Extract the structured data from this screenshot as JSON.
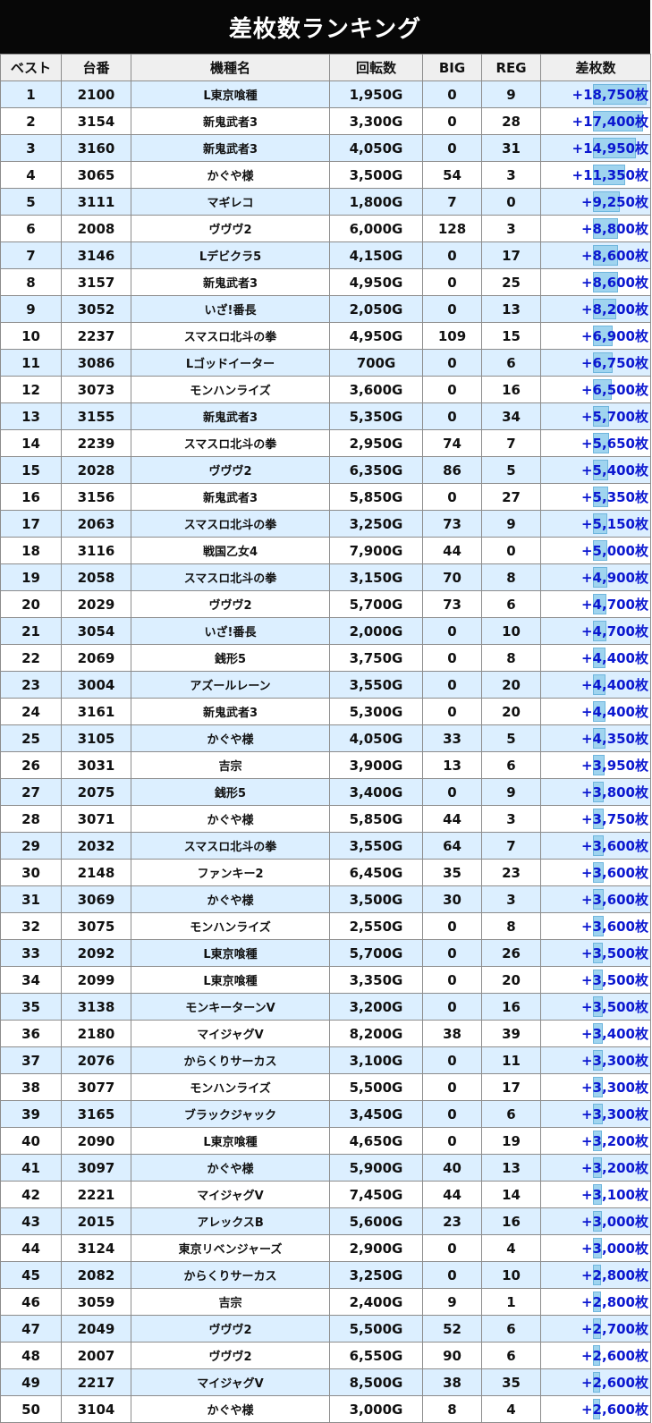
{
  "title": "差枚数ランキング",
  "colors": {
    "title_bg": "#070707",
    "header_bg": "#efefef",
    "row_alt_bg": "#dcefff",
    "diff_text": "#0b17d0",
    "diff_bar": "#9fd4ef"
  },
  "columns": [
    "ベスト",
    "台番",
    "機種名",
    "回転数",
    "BIG",
    "REG",
    "差枚数"
  ],
  "rows": [
    {
      "rank": "1",
      "machine_no": "2100",
      "name": "L東京喰種",
      "spins": "1,950G",
      "big": "0",
      "reg": "9",
      "diff": "+18,750枚",
      "diff_value": 18750
    },
    {
      "rank": "2",
      "machine_no": "3154",
      "name": "新鬼武者3",
      "spins": "3,300G",
      "big": "0",
      "reg": "28",
      "diff": "+17,400枚",
      "diff_value": 17400
    },
    {
      "rank": "3",
      "machine_no": "3160",
      "name": "新鬼武者3",
      "spins": "4,050G",
      "big": "0",
      "reg": "31",
      "diff": "+14,950枚",
      "diff_value": 14950
    },
    {
      "rank": "4",
      "machine_no": "3065",
      "name": "かぐや様",
      "spins": "3,500G",
      "big": "54",
      "reg": "3",
      "diff": "+11,350枚",
      "diff_value": 11350
    },
    {
      "rank": "5",
      "machine_no": "3111",
      "name": "マギレコ",
      "spins": "1,800G",
      "big": "7",
      "reg": "0",
      "diff": "+9,250枚",
      "diff_value": 9250
    },
    {
      "rank": "6",
      "machine_no": "2008",
      "name": "ヴヴヴ2",
      "spins": "6,000G",
      "big": "128",
      "reg": "3",
      "diff": "+8,800枚",
      "diff_value": 8800
    },
    {
      "rank": "7",
      "machine_no": "3146",
      "name": "Lデビクラ5",
      "spins": "4,150G",
      "big": "0",
      "reg": "17",
      "diff": "+8,600枚",
      "diff_value": 8600
    },
    {
      "rank": "8",
      "machine_no": "3157",
      "name": "新鬼武者3",
      "spins": "4,950G",
      "big": "0",
      "reg": "25",
      "diff": "+8,600枚",
      "diff_value": 8600
    },
    {
      "rank": "9",
      "machine_no": "3052",
      "name": "いざ!番長",
      "spins": "2,050G",
      "big": "0",
      "reg": "13",
      "diff": "+8,200枚",
      "diff_value": 8200
    },
    {
      "rank": "10",
      "machine_no": "2237",
      "name": "スマスロ北斗の拳",
      "spins": "4,950G",
      "big": "109",
      "reg": "15",
      "diff": "+6,900枚",
      "diff_value": 6900
    },
    {
      "rank": "11",
      "machine_no": "3086",
      "name": "Lゴッドイーター",
      "spins": "700G",
      "big": "0",
      "reg": "6",
      "diff": "+6,750枚",
      "diff_value": 6750
    },
    {
      "rank": "12",
      "machine_no": "3073",
      "name": "モンハンライズ",
      "spins": "3,600G",
      "big": "0",
      "reg": "16",
      "diff": "+6,500枚",
      "diff_value": 6500
    },
    {
      "rank": "13",
      "machine_no": "3155",
      "name": "新鬼武者3",
      "spins": "5,350G",
      "big": "0",
      "reg": "34",
      "diff": "+5,700枚",
      "diff_value": 5700
    },
    {
      "rank": "14",
      "machine_no": "2239",
      "name": "スマスロ北斗の拳",
      "spins": "2,950G",
      "big": "74",
      "reg": "7",
      "diff": "+5,650枚",
      "diff_value": 5650
    },
    {
      "rank": "15",
      "machine_no": "2028",
      "name": "ヴヴヴ2",
      "spins": "6,350G",
      "big": "86",
      "reg": "5",
      "diff": "+5,400枚",
      "diff_value": 5400
    },
    {
      "rank": "16",
      "machine_no": "3156",
      "name": "新鬼武者3",
      "spins": "5,850G",
      "big": "0",
      "reg": "27",
      "diff": "+5,350枚",
      "diff_value": 5350
    },
    {
      "rank": "17",
      "machine_no": "2063",
      "name": "スマスロ北斗の拳",
      "spins": "3,250G",
      "big": "73",
      "reg": "9",
      "diff": "+5,150枚",
      "diff_value": 5150
    },
    {
      "rank": "18",
      "machine_no": "3116",
      "name": "戦国乙女4",
      "spins": "7,900G",
      "big": "44",
      "reg": "0",
      "diff": "+5,000枚",
      "diff_value": 5000
    },
    {
      "rank": "19",
      "machine_no": "2058",
      "name": "スマスロ北斗の拳",
      "spins": "3,150G",
      "big": "70",
      "reg": "8",
      "diff": "+4,900枚",
      "diff_value": 4900
    },
    {
      "rank": "20",
      "machine_no": "2029",
      "name": "ヴヴヴ2",
      "spins": "5,700G",
      "big": "73",
      "reg": "6",
      "diff": "+4,700枚",
      "diff_value": 4700
    },
    {
      "rank": "21",
      "machine_no": "3054",
      "name": "いざ!番長",
      "spins": "2,000G",
      "big": "0",
      "reg": "10",
      "diff": "+4,700枚",
      "diff_value": 4700
    },
    {
      "rank": "22",
      "machine_no": "2069",
      "name": "銭形5",
      "spins": "3,750G",
      "big": "0",
      "reg": "8",
      "diff": "+4,400枚",
      "diff_value": 4400
    },
    {
      "rank": "23",
      "machine_no": "3004",
      "name": "アズールレーン",
      "spins": "3,550G",
      "big": "0",
      "reg": "20",
      "diff": "+4,400枚",
      "diff_value": 4400
    },
    {
      "rank": "24",
      "machine_no": "3161",
      "name": "新鬼武者3",
      "spins": "5,300G",
      "big": "0",
      "reg": "20",
      "diff": "+4,400枚",
      "diff_value": 4400
    },
    {
      "rank": "25",
      "machine_no": "3105",
      "name": "かぐや様",
      "spins": "4,050G",
      "big": "33",
      "reg": "5",
      "diff": "+4,350枚",
      "diff_value": 4350
    },
    {
      "rank": "26",
      "machine_no": "3031",
      "name": "吉宗",
      "spins": "3,900G",
      "big": "13",
      "reg": "6",
      "diff": "+3,950枚",
      "diff_value": 3950
    },
    {
      "rank": "27",
      "machine_no": "2075",
      "name": "銭形5",
      "spins": "3,400G",
      "big": "0",
      "reg": "9",
      "diff": "+3,800枚",
      "diff_value": 3800
    },
    {
      "rank": "28",
      "machine_no": "3071",
      "name": "かぐや様",
      "spins": "5,850G",
      "big": "44",
      "reg": "3",
      "diff": "+3,750枚",
      "diff_value": 3750
    },
    {
      "rank": "29",
      "machine_no": "2032",
      "name": "スマスロ北斗の拳",
      "spins": "3,550G",
      "big": "64",
      "reg": "7",
      "diff": "+3,600枚",
      "diff_value": 3600
    },
    {
      "rank": "30",
      "machine_no": "2148",
      "name": "ファンキー2",
      "spins": "6,450G",
      "big": "35",
      "reg": "23",
      "diff": "+3,600枚",
      "diff_value": 3600
    },
    {
      "rank": "31",
      "machine_no": "3069",
      "name": "かぐや様",
      "spins": "3,500G",
      "big": "30",
      "reg": "3",
      "diff": "+3,600枚",
      "diff_value": 3600
    },
    {
      "rank": "32",
      "machine_no": "3075",
      "name": "モンハンライズ",
      "spins": "2,550G",
      "big": "0",
      "reg": "8",
      "diff": "+3,600枚",
      "diff_value": 3600
    },
    {
      "rank": "33",
      "machine_no": "2092",
      "name": "L東京喰種",
      "spins": "5,700G",
      "big": "0",
      "reg": "26",
      "diff": "+3,500枚",
      "diff_value": 3500
    },
    {
      "rank": "34",
      "machine_no": "2099",
      "name": "L東京喰種",
      "spins": "3,350G",
      "big": "0",
      "reg": "20",
      "diff": "+3,500枚",
      "diff_value": 3500
    },
    {
      "rank": "35",
      "machine_no": "3138",
      "name": "モンキーターンV",
      "spins": "3,200G",
      "big": "0",
      "reg": "16",
      "diff": "+3,500枚",
      "diff_value": 3500
    },
    {
      "rank": "36",
      "machine_no": "2180",
      "name": "マイジャグV",
      "spins": "8,200G",
      "big": "38",
      "reg": "39",
      "diff": "+3,400枚",
      "diff_value": 3400
    },
    {
      "rank": "37",
      "machine_no": "2076",
      "name": "からくりサーカス",
      "spins": "3,100G",
      "big": "0",
      "reg": "11",
      "diff": "+3,300枚",
      "diff_value": 3300
    },
    {
      "rank": "38",
      "machine_no": "3077",
      "name": "モンハンライズ",
      "spins": "5,500G",
      "big": "0",
      "reg": "17",
      "diff": "+3,300枚",
      "diff_value": 3300
    },
    {
      "rank": "39",
      "machine_no": "3165",
      "name": "ブラックジャック",
      "spins": "3,450G",
      "big": "0",
      "reg": "6",
      "diff": "+3,300枚",
      "diff_value": 3300
    },
    {
      "rank": "40",
      "machine_no": "2090",
      "name": "L東京喰種",
      "spins": "4,650G",
      "big": "0",
      "reg": "19",
      "diff": "+3,200枚",
      "diff_value": 3200
    },
    {
      "rank": "41",
      "machine_no": "3097",
      "name": "かぐや様",
      "spins": "5,900G",
      "big": "40",
      "reg": "13",
      "diff": "+3,200枚",
      "diff_value": 3200
    },
    {
      "rank": "42",
      "machine_no": "2221",
      "name": "マイジャグV",
      "spins": "7,450G",
      "big": "44",
      "reg": "14",
      "diff": "+3,100枚",
      "diff_value": 3100
    },
    {
      "rank": "43",
      "machine_no": "2015",
      "name": "アレックスB",
      "spins": "5,600G",
      "big": "23",
      "reg": "16",
      "diff": "+3,000枚",
      "diff_value": 3000
    },
    {
      "rank": "44",
      "machine_no": "3124",
      "name": "東京リベンジャーズ",
      "spins": "2,900G",
      "big": "0",
      "reg": "4",
      "diff": "+3,000枚",
      "diff_value": 3000
    },
    {
      "rank": "45",
      "machine_no": "2082",
      "name": "からくりサーカス",
      "spins": "3,250G",
      "big": "0",
      "reg": "10",
      "diff": "+2,800枚",
      "diff_value": 2800
    },
    {
      "rank": "46",
      "machine_no": "3059",
      "name": "吉宗",
      "spins": "2,400G",
      "big": "9",
      "reg": "1",
      "diff": "+2,800枚",
      "diff_value": 2800
    },
    {
      "rank": "47",
      "machine_no": "2049",
      "name": "ヴヴヴ2",
      "spins": "5,500G",
      "big": "52",
      "reg": "6",
      "diff": "+2,700枚",
      "diff_value": 2700
    },
    {
      "rank": "48",
      "machine_no": "2007",
      "name": "ヴヴヴ2",
      "spins": "6,550G",
      "big": "90",
      "reg": "6",
      "diff": "+2,600枚",
      "diff_value": 2600
    },
    {
      "rank": "49",
      "machine_no": "2217",
      "name": "マイジャグV",
      "spins": "8,500G",
      "big": "38",
      "reg": "35",
      "diff": "+2,600枚",
      "diff_value": 2600
    },
    {
      "rank": "50",
      "machine_no": "3104",
      "name": "かぐや様",
      "spins": "3,000G",
      "big": "8",
      "reg": "4",
      "diff": "+2,600枚",
      "diff_value": 2600
    }
  ]
}
